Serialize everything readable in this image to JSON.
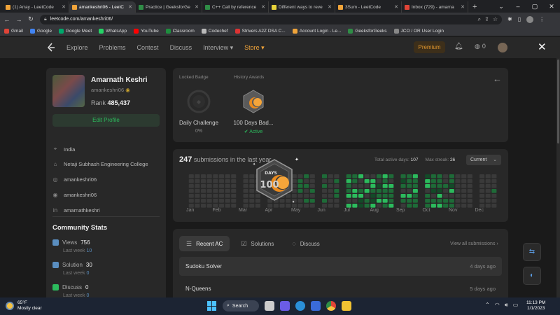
{
  "browser": {
    "tabs": [
      {
        "title": "(1) Array - LeetCode",
        "color": "#f0a43a",
        "active": false
      },
      {
        "title": "amankeshri06 - LeetC",
        "color": "#f0a43a",
        "active": true
      },
      {
        "title": "Practice | GeeksforGe",
        "color": "#2f8d46",
        "active": false
      },
      {
        "title": "C++ Call by reference",
        "color": "#2f8d46",
        "active": false
      },
      {
        "title": "Different ways to reve",
        "color": "#e8d33a",
        "active": false
      },
      {
        "title": "3Sum - LeetCode",
        "color": "#f0a43a",
        "active": false
      },
      {
        "title": "Inbox (729) - amarna",
        "color": "#e04437",
        "active": false
      }
    ],
    "url": "leetcode.com/amankeshri06/",
    "bookmarks": [
      {
        "label": "Gmail",
        "color": "#e04437"
      },
      {
        "label": "Google",
        "color": "#4285f4"
      },
      {
        "label": "Google Meet",
        "color": "#00a86b"
      },
      {
        "label": "WhatsApp",
        "color": "#25d366"
      },
      {
        "label": "YouTube",
        "color": "#ff0000"
      },
      {
        "label": "Classroom",
        "color": "#1e8e3e"
      },
      {
        "label": "Codechef",
        "color": "#b9b9b9"
      },
      {
        "label": "Strivers A2Z DSA C...",
        "color": "#d33"
      },
      {
        "label": "Account Login - Le...",
        "color": "#f0a43a"
      },
      {
        "label": "GeeksforGeeks",
        "color": "#2f8d46"
      },
      {
        "label": "JCO / OR User Login",
        "color": "#888"
      }
    ]
  },
  "nav": {
    "links": [
      "Explore",
      "Problems",
      "Contest",
      "Discuss",
      "Interview ▾",
      "Store ▾"
    ],
    "premium": "Premium",
    "coins": "0"
  },
  "profile": {
    "name": "Amarnath Keshri",
    "username": "amankeshri06",
    "rank_label": "Rank",
    "rank_value": "485,437",
    "edit_label": "Edit Profile",
    "info": [
      {
        "icon": "⌖",
        "text": "India"
      },
      {
        "icon": "⌂",
        "text": "Netaji Subhash Engineering College"
      },
      {
        "icon": "◎",
        "text": "amankeshri06"
      },
      {
        "icon": "◉",
        "text": "amankeshri06"
      },
      {
        "icon": "in",
        "text": "amarnathkeshri"
      }
    ],
    "community_title": "Community Stats",
    "stats": [
      {
        "label": "Views",
        "value": "756",
        "last": "Last week",
        "delta": "10",
        "color": "#5a8ec0"
      },
      {
        "label": "Solution",
        "value": "30",
        "last": "Last week",
        "delta": "0",
        "color": "#5a8ec0"
      },
      {
        "label": "Discuss",
        "value": "0",
        "last": "Last week",
        "delta": "0",
        "color": "#2cbb5d"
      }
    ]
  },
  "badges": {
    "locked_label": "Locked Badge",
    "history_label": "History Awards",
    "locked_name": "Daily Challenge",
    "locked_progress": "0%",
    "history_name": "100 Days Bad...",
    "history_status": "Active"
  },
  "submissions": {
    "count": "247",
    "title_rest": "submissions in the last year",
    "active_days_label": "Total active days:",
    "active_days": "107",
    "max_streak_label": "Max streak:",
    "max_streak": "26",
    "dropdown": "Current",
    "months": [
      "Jan",
      "Feb",
      "Mar",
      "Apr",
      "May",
      "Jun",
      "Jul",
      "Aug",
      "Sep",
      "Oct",
      "Nov",
      "Dec"
    ],
    "popup_badge_text": "DAYS",
    "popup_badge_number": "100"
  },
  "recent": {
    "tabs": [
      "Recent AC",
      "Solutions",
      "Discuss"
    ],
    "view_all": "View all submissions",
    "items": [
      {
        "title": "Sudoku Solver",
        "when": "4 days ago"
      },
      {
        "title": "N-Queens",
        "when": "5 days ago"
      }
    ]
  },
  "taskbar": {
    "temp": "65°F",
    "weather": "Mostly clear",
    "search": "Search",
    "time": "11:13 PM",
    "date": "1/1/2023"
  }
}
